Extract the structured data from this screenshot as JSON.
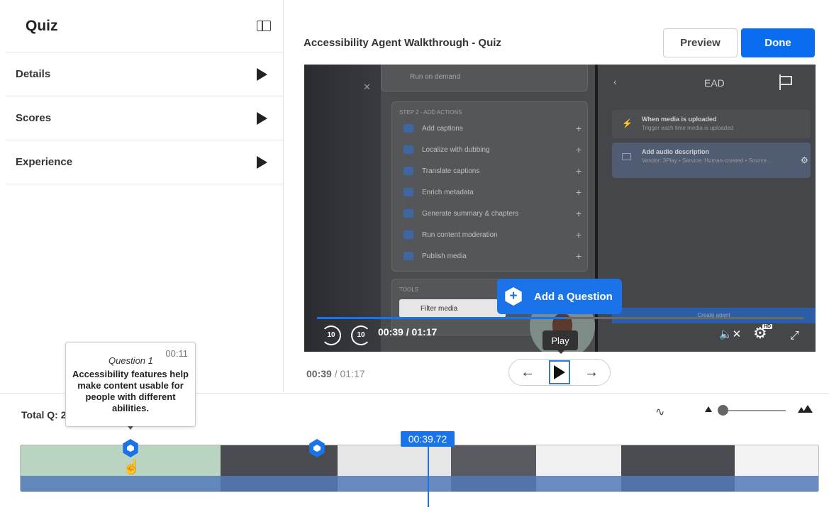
{
  "sidebar": {
    "title": "Quiz",
    "items": [
      {
        "label": "Details"
      },
      {
        "label": "Scores"
      },
      {
        "label": "Experience"
      }
    ]
  },
  "header": {
    "video_title": "Accessibility Agent Walkthrough - Quiz",
    "preview_label": "Preview",
    "done_label": "Done"
  },
  "video": {
    "menu_card_text": "Run on demand",
    "step_label": "STEP 2 - ADD ACTIONS",
    "actions": [
      "Add captions",
      "Localize with dubbing",
      "Translate captions",
      "Enrich metadata",
      "Generate summary & chapters",
      "Run content moderation",
      "Publish media"
    ],
    "tools_label": "TOOLS",
    "filter_label": "Filter media",
    "right_title": "EAD",
    "card1_title": "When media is uploaded",
    "card1_sub": "Trigger each time media is uploaded",
    "card2_title": "Add audio description",
    "card2_sub": "Vendor: 3Play • Service: Human-created • Source...",
    "create_label": "Create agent",
    "add_question_label": "Add a Question",
    "skip_back": "10",
    "skip_fwd": "10",
    "current_time": "00:39",
    "duration": "01:17",
    "progress": 0.51,
    "hd_badge": "HD"
  },
  "player_controls": {
    "play_tooltip": "Play",
    "current_time": "00:39",
    "separator": " / ",
    "total_time": "01:17"
  },
  "timeline": {
    "total_label": "Total Q: 2",
    "playhead_time": "00:39.72",
    "question": {
      "number_label": "Question 1",
      "time": "00:11",
      "text": "Accessibility features help make content usable for people with different abilities."
    }
  },
  "colors": {
    "accent": "#1a73e8",
    "done_button": "#0a6df0"
  }
}
